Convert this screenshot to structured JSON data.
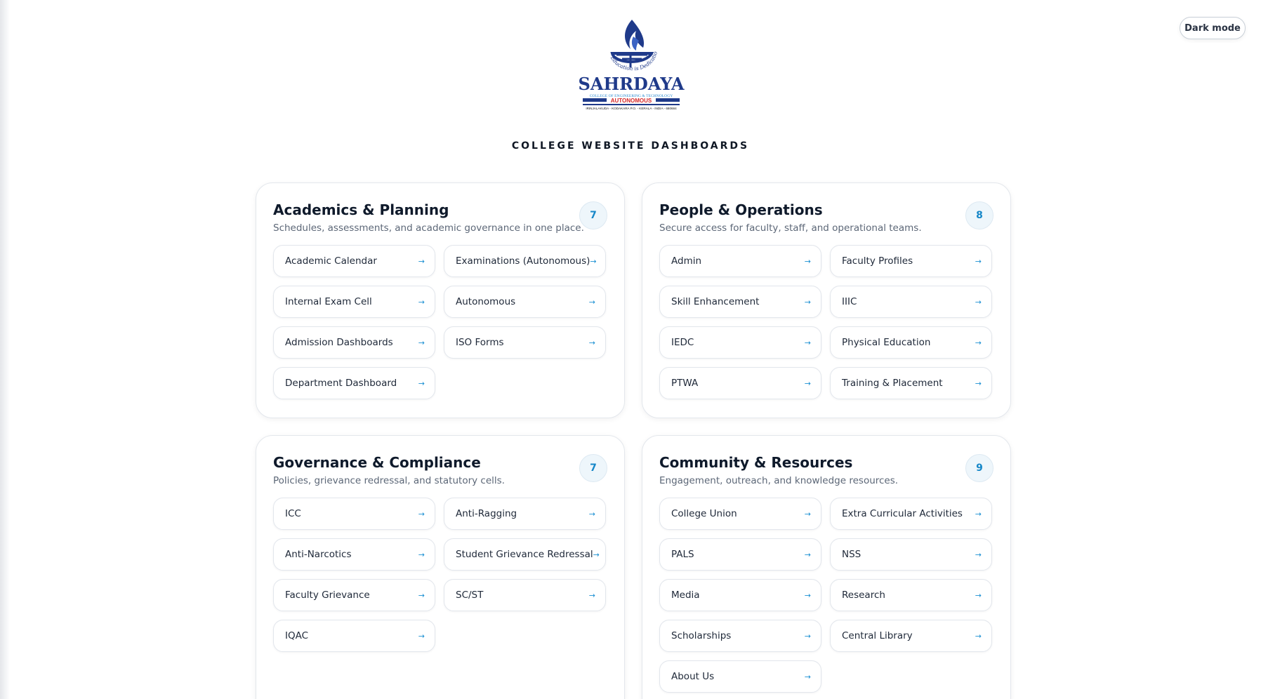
{
  "toggle": {
    "label": "Dark mode"
  },
  "logo": {
    "tagline": "Education is Dedication",
    "name": "SAHRDAYA",
    "line1": "COLLEGE OF ENGINEERING & TECHNOLOGY",
    "line2": "AUTONOMOUS",
    "line3": "IRINJALAKUDA - KODAKARA P.O. - KERALA - INDIA - 680684"
  },
  "page_title": "COLLEGE WEBSITE DASHBOARDS",
  "colors": {
    "accent": "#1a8fd2",
    "brand_navy": "#1f3a8a",
    "brand_red": "#d62828"
  },
  "cards": [
    {
      "title": "Academics & Planning",
      "subtitle": "Schedules, assessments, and academic governance in one place.",
      "count": "7",
      "links": [
        "Academic Calendar",
        "Examinations (Autonomous)",
        "Internal Exam Cell",
        "Autonomous",
        "Admission Dashboards",
        "ISO Forms",
        "Department Dashboard"
      ]
    },
    {
      "title": "People & Operations",
      "subtitle": "Secure access for faculty, staff, and operational teams.",
      "count": "8",
      "links": [
        "Admin",
        "Faculty Profiles",
        "Skill Enhancement",
        "IIIC",
        "IEDC",
        "Physical Education",
        "PTWA",
        "Training & Placement"
      ]
    },
    {
      "title": "Governance & Compliance",
      "subtitle": "Policies, grievance redressal, and statutory cells.",
      "count": "7",
      "links": [
        "ICC",
        "Anti-Ragging",
        "Anti-Narcotics",
        "Student Grievance Redressal",
        "Faculty Grievance",
        "SC/ST",
        "IQAC"
      ]
    },
    {
      "title": "Community & Resources",
      "subtitle": "Engagement, outreach, and knowledge resources.",
      "count": "9",
      "links": [
        "College Union",
        "Extra Curricular Activities",
        "PALS",
        "NSS",
        "Media",
        "Research",
        "Scholarships",
        "Central Library",
        "About Us"
      ]
    }
  ],
  "icons": {
    "link_arrow": "arrow-right-icon",
    "theme": "moon-icon"
  }
}
